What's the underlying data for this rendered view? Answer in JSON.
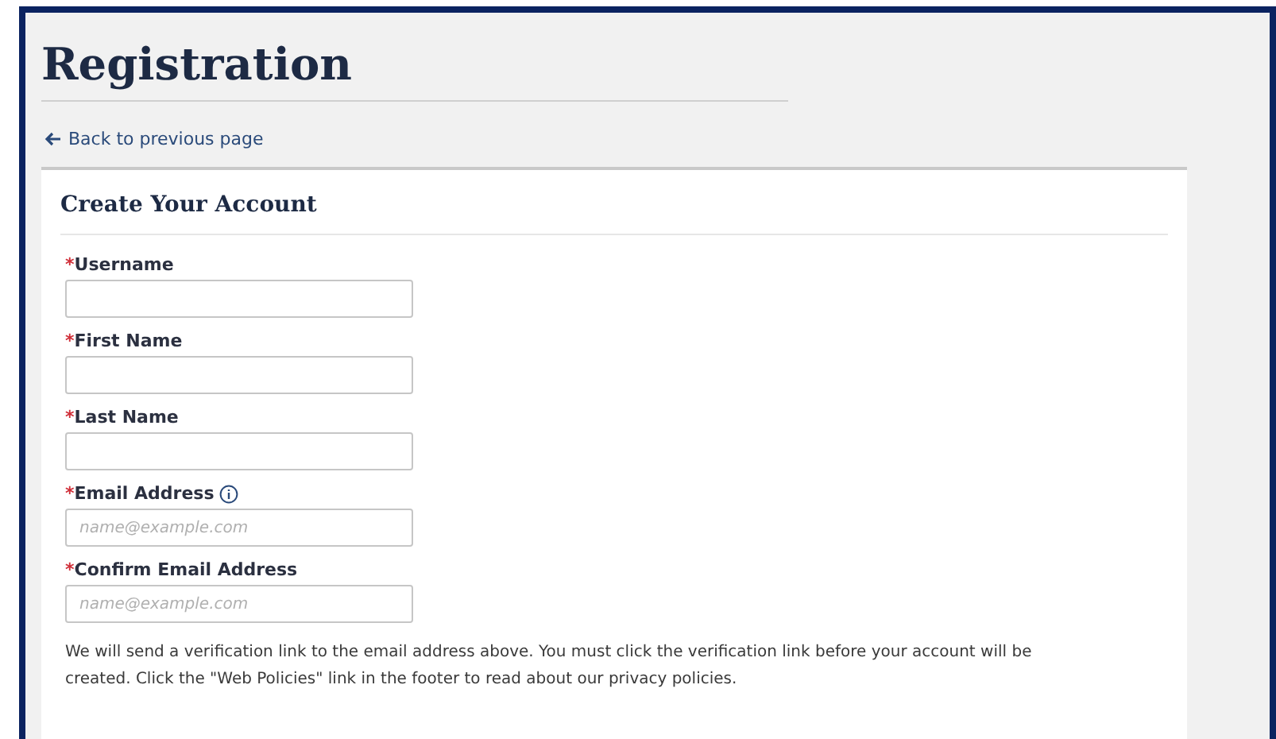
{
  "page": {
    "title": "Registration",
    "back_link": "Back to previous page"
  },
  "form": {
    "heading": "Create Your Account",
    "fields": [
      {
        "label": "Username",
        "required": "*",
        "info": false
      },
      {
        "label": "First Name",
        "required": "*",
        "info": false
      },
      {
        "label": "Last Name",
        "required": "*",
        "info": false
      },
      {
        "label": "Email Address",
        "required": "*",
        "info": true,
        "placeholder": "name@example.com"
      },
      {
        "label": "Confirm Email Address",
        "required": "*",
        "info": false,
        "placeholder": "name@example.com"
      }
    ],
    "note": "We will send a verification link to the email address above. You must click the verification link before your account will be created. Click the \"Web Policies\" link in the footer to read about our privacy policies."
  }
}
